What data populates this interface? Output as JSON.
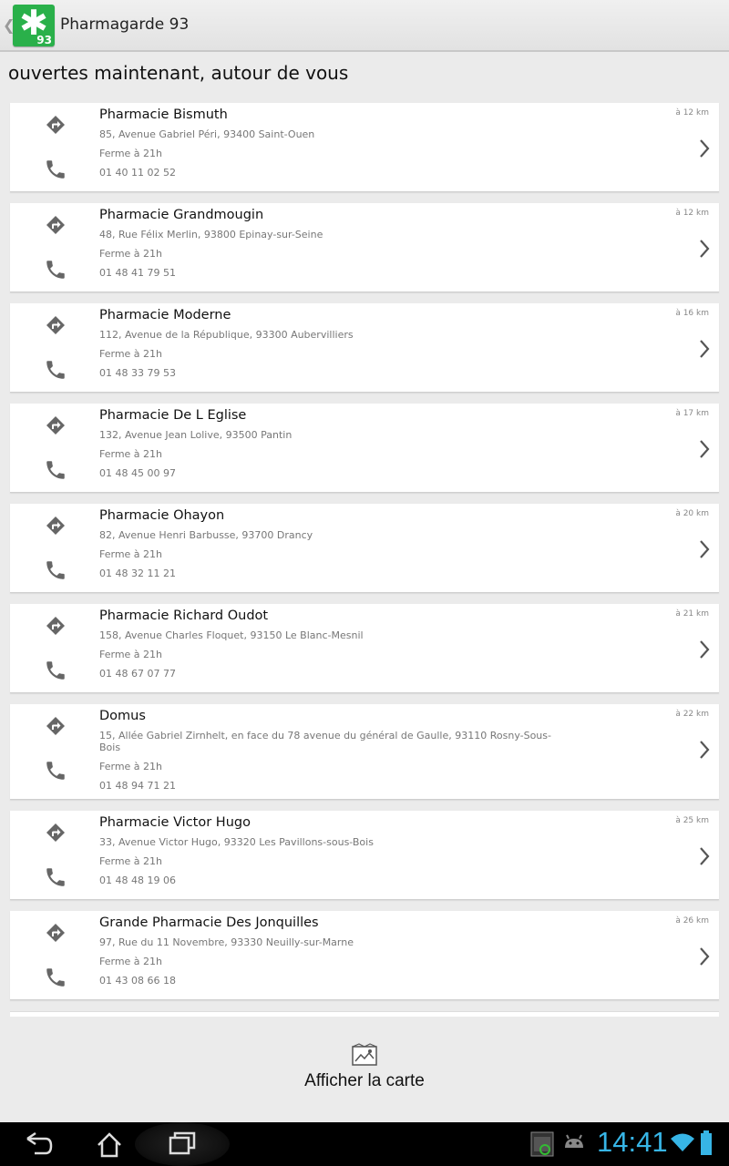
{
  "app": {
    "title": "Pharmagarde 93",
    "logo_number": "93"
  },
  "heading": "ouvertes maintenant, autour de vous",
  "pharmacies": [
    {
      "name": "Pharmacie Bismuth",
      "address": "85, Avenue Gabriel Péri, 93400 Saint-Ouen",
      "hours": "Ferme à 21h",
      "phone": "01 40 11 02 52",
      "distance": "à 12 km"
    },
    {
      "name": "Pharmacie Grandmougin",
      "address": "48, Rue Félix Merlin, 93800 Epinay-sur-Seine",
      "hours": "Ferme à 21h",
      "phone": "01 48 41 79 51",
      "distance": "à 12 km"
    },
    {
      "name": "Pharmacie Moderne",
      "address": "112, Avenue de la République, 93300 Aubervilliers",
      "hours": "Ferme à 21h",
      "phone": "01 48 33 79 53",
      "distance": "à 16 km"
    },
    {
      "name": "Pharmacie De L Eglise",
      "address": "132, Avenue Jean Lolive, 93500 Pantin",
      "hours": "Ferme à 21h",
      "phone": "01 48 45 00 97",
      "distance": "à 17 km"
    },
    {
      "name": "Pharmacie Ohayon",
      "address": "82, Avenue Henri Barbusse, 93700 Drancy",
      "hours": "Ferme à 21h",
      "phone": "01 48 32 11 21",
      "distance": "à 20 km"
    },
    {
      "name": "Pharmacie Richard Oudot",
      "address": "158, Avenue Charles Floquet, 93150 Le Blanc-Mesnil",
      "hours": "Ferme à 21h",
      "phone": "01 48 67 07 77",
      "distance": "à 21 km"
    },
    {
      "name": "Domus",
      "address": "15, Allée Gabriel Zirnhelt, en face du 78 avenue du général de Gaulle, 93110 Rosny-Sous-Bois",
      "hours": "Ferme à 21h",
      "phone": "01 48 94 71 21",
      "distance": "à 22 km"
    },
    {
      "name": "Pharmacie Victor Hugo",
      "address": "33, Avenue Victor Hugo, 93320 Les Pavillons-sous-Bois",
      "hours": "Ferme à 21h",
      "phone": "01 48 48 19 06",
      "distance": "à 25 km"
    },
    {
      "name": "Grande Pharmacie Des Jonquilles",
      "address": "97, Rue du 11 Novembre, 93330 Neuilly-sur-Marne",
      "hours": "Ferme à 21h",
      "phone": "01 43 08 66 18",
      "distance": "à 26 km"
    }
  ],
  "map_button": {
    "label": "Afficher la carte",
    "icon": "map-icon"
  },
  "status": {
    "time": "14:41"
  },
  "icons": {
    "direction": "directions-icon",
    "phone": "phone-icon",
    "chevron": "chevron-right-icon"
  },
  "colors": {
    "accent": "#2ab04a",
    "clock": "#37b5e6"
  }
}
